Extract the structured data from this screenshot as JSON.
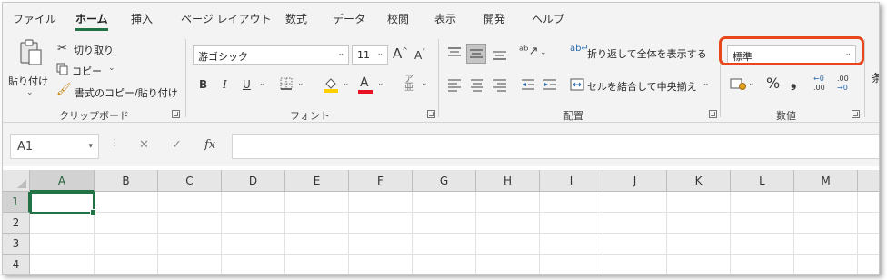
{
  "tabs": [
    "ファイル",
    "ホーム",
    "挿入",
    "ページ レイアウト",
    "数式",
    "データ",
    "校閲",
    "表示",
    "開発",
    "ヘルプ"
  ],
  "clipboard": {
    "paste": "貼り付け",
    "cut": "切り取り",
    "copy": "コピー",
    "format_painter": "書式のコピー/貼り付け",
    "label": "クリップボード"
  },
  "font": {
    "name": "游ゴシック",
    "size": "11",
    "bold": "B",
    "italic": "I",
    "underline": "U",
    "grow": "A",
    "shrink": "A",
    "color_letter": "A",
    "fill_color": "#FFD000",
    "font_color": "#E81123",
    "label": "フォント"
  },
  "alignment": {
    "wrap": "折り返して全体を表示する",
    "merge": "セルを結合して中央揃え",
    "label": "配置"
  },
  "number": {
    "format": "標準",
    "percent": "%",
    "comma": "❟",
    "inc_decimal_top": "←0",
    "inc_decimal_bottom": ".00",
    "dec_decimal_top": ".00",
    "dec_decimal_bottom": "→0",
    "label": "数値",
    "highlight_color": "#E8471C"
  },
  "cond_format_partial": "条",
  "formula_bar": {
    "name_box": "A1",
    "cancel": "✕",
    "enter": "✓",
    "fx": "fx",
    "value": ""
  },
  "grid": {
    "columns": [
      "A",
      "B",
      "C",
      "D",
      "E",
      "F",
      "G",
      "H",
      "I",
      "J",
      "K",
      "L",
      "M"
    ],
    "rows": [
      "1",
      "2",
      "3",
      "4"
    ],
    "selected_cell": "A1"
  }
}
